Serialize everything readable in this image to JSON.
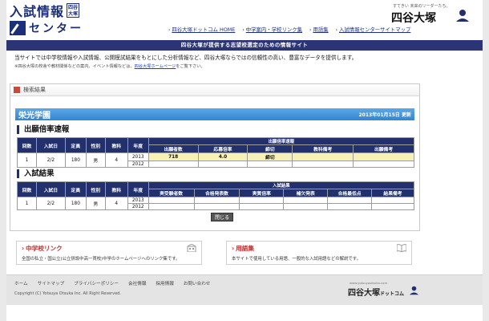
{
  "header": {
    "logo_main": "入試情報",
    "logo_stamp": "四谷大塚",
    "logo_sub": "センター",
    "brand_tagline": "すてきい 未来のリーダーたち。",
    "brand_name": "四谷大塚",
    "links": [
      "四谷大塚ドットコム HOME",
      "中学案内・学校リンク集",
      "用語集",
      "入試情報センターサイトマップ"
    ]
  },
  "notice": "四谷大塚が提供する志望校選定のための情報サイト",
  "intro": {
    "line1": "当サイトでは中学校情報や入試情報、公開模試結果をもとにした分析情報など、四谷大塚ならではの信頼性の高い、豊富なデータを提供します。",
    "line2_text": "※四谷大塚の校舎や教材関係などの案内、イベント情報などは、",
    "line2_link": "四谷大塚ホームページ",
    "line2_tail": "をご覧下さい。"
  },
  "result": {
    "title": "検索結果",
    "school_name": "栄光学園",
    "date": "2013年01月15日 更新",
    "section1_title": "出願倍率速報",
    "section2_title": "入試結果",
    "table1": {
      "headers": [
        "回数",
        "入試日",
        "定員",
        "性別",
        "教科",
        "年度"
      ],
      "group_header": "出願倍率速報",
      "sub_headers": [
        "出願者数",
        "応募倍率",
        "締切",
        "教科備考",
        "出願備考"
      ],
      "row": {
        "no": "1",
        "date": "2/2",
        "capacity": "180",
        "gender": "男",
        "subjects": "4",
        "years": [
          "2013",
          "2012"
        ],
        "applicants": "718",
        "ratio": "4.0",
        "deadline": "締切",
        "subject_note": "",
        "app_note": ""
      }
    },
    "table2": {
      "headers": [
        "回数",
        "入試日",
        "定員",
        "性別",
        "教科",
        "年度"
      ],
      "group_header": "入試結果",
      "sub_headers": [
        "実受験者数",
        "合格発表数",
        "実質倍率",
        "補欠発表",
        "合格最低点",
        "結果備考"
      ],
      "row": {
        "no": "1",
        "date": "2/2",
        "capacity": "180",
        "gender": "男",
        "subjects": "4",
        "years": [
          "2013",
          "2012"
        ]
      }
    },
    "close_label": "閉じる"
  },
  "cards": [
    {
      "title": "中学校リンク",
      "desc": "全国の私立・国公立(公立併設中高一貫校)中学のホームページへのリンク集です。"
    },
    {
      "title": "用語集",
      "desc": "本サイトで使用している用語、一般的な入試用語などの解説です。"
    }
  ],
  "footer": {
    "links": [
      "ホーム",
      "サイトマップ",
      "プライバシーポリシー",
      "会社情報",
      "採用情報",
      "お問い合わせ"
    ],
    "copyright": "Copyright (C) Yotsuya Otsuka Inc. All Right Reserved.",
    "brand_url": "www.yotsuyaotsuka.com",
    "brand_name": "四谷大塚",
    "brand_suffix": "ドットコム"
  },
  "colors": {
    "navy": "#23306e",
    "accent_blue": "#3385d1",
    "highlight": "#f7f1b6",
    "link_red": "#c32d2d"
  }
}
